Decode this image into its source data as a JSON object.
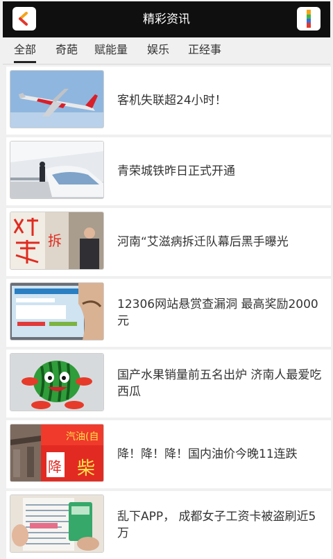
{
  "header": {
    "title": "精彩资讯",
    "back_icon": "back-arrow-icon",
    "menu_icon": "menu-icon"
  },
  "tabs": [
    {
      "label": "全部",
      "active": true
    },
    {
      "label": "奇葩",
      "active": false
    },
    {
      "label": "赋能量",
      "active": false
    },
    {
      "label": "娱乐",
      "active": false
    },
    {
      "label": "正经事",
      "active": false
    }
  ],
  "news": [
    {
      "title": "客机失联超24小时！",
      "image": "airplane-photo"
    },
    {
      "title": "青荣城铁昨日正式开通",
      "image": "high-speed-train-photo"
    },
    {
      "title": "河南“艾滋病拆迁队幕后黑手曝光",
      "image": "demolition-wall-photo"
    },
    {
      "title": "12306网站悬赏查漏洞 最高奖励2000元",
      "image": "website-screen-photo"
    },
    {
      "title": "国产水果销量前五名出炉 济南人最爱吃西瓜",
      "image": "watermelon-cartoon"
    },
    {
      "title": "降！降！降！国内油价今晚11连跌",
      "image": "gas-station-sign-photo"
    },
    {
      "title": "乱下APP， 成都女子工资卡被盗刷近5万",
      "image": "bank-card-photo"
    }
  ],
  "thumb_text": {
    "demolition": "拆",
    "gas_sign": "汽油(自",
    "gas_sign_2": "柴",
    "gas_down": "降"
  }
}
